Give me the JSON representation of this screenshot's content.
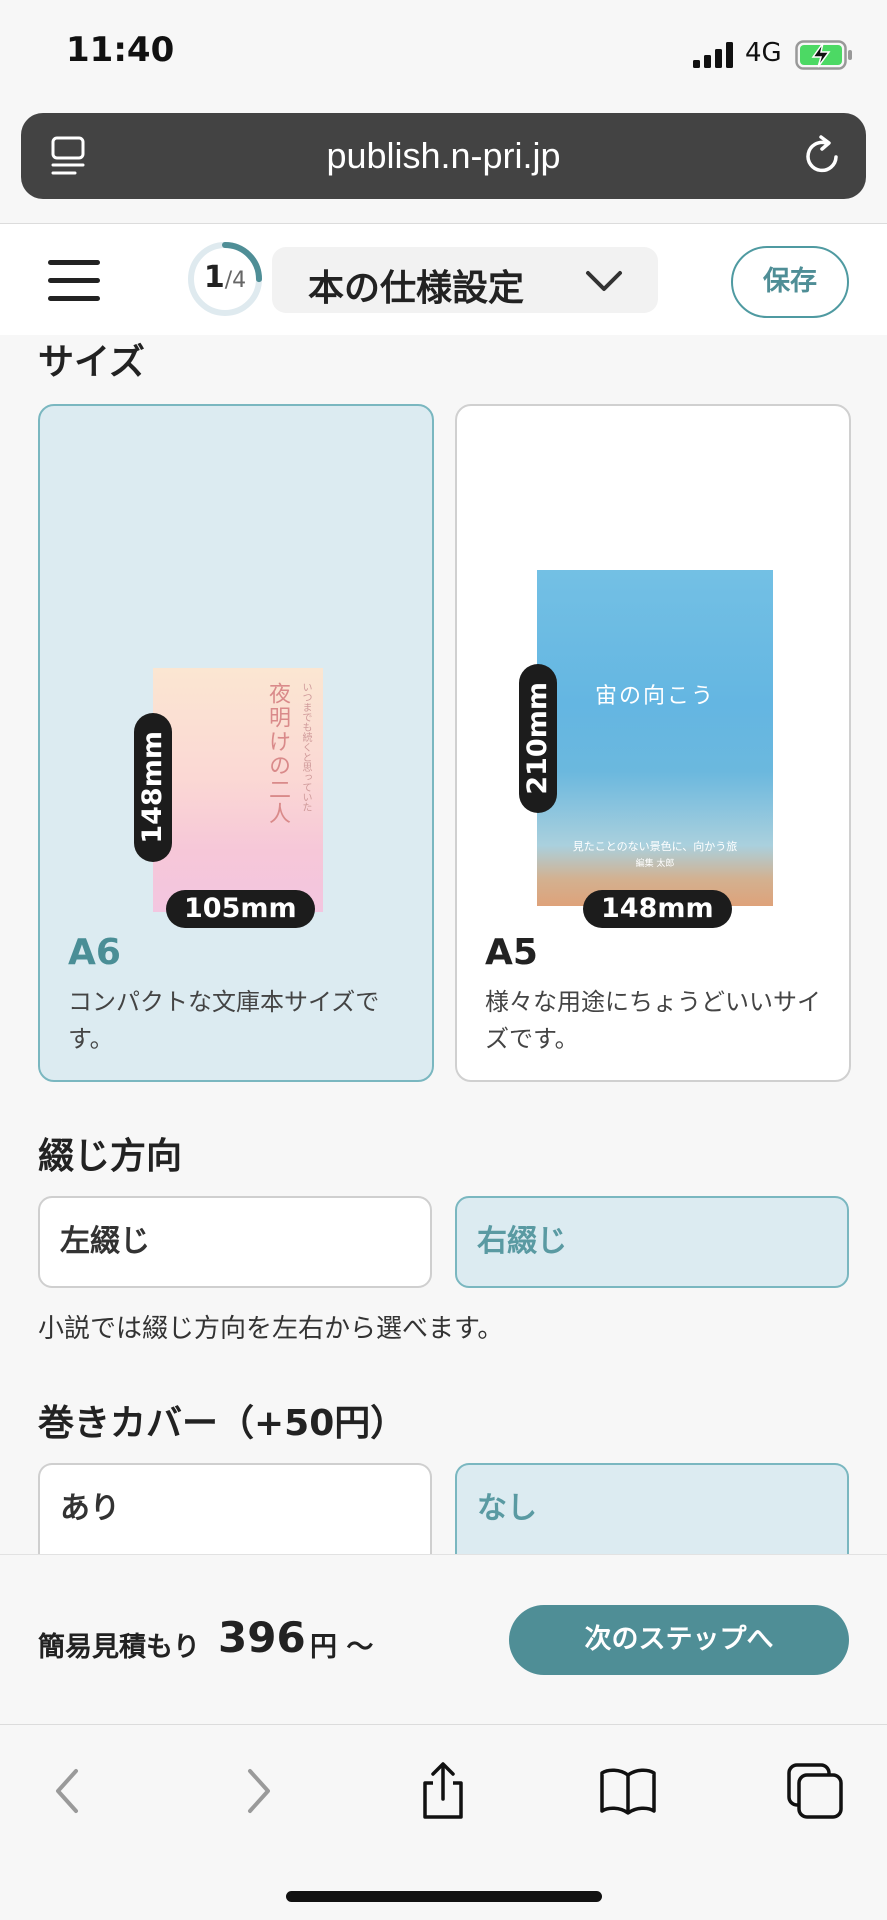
{
  "status_bar": {
    "time": "11:40",
    "network": "4G"
  },
  "browser": {
    "url": "publish.n-pri.jp"
  },
  "header": {
    "step_current": "1",
    "step_total": "/4",
    "step_progress": 0.25,
    "step_title": "本の仕様設定",
    "save_label": "保存"
  },
  "size_section": {
    "title": "サイズ",
    "options": [
      {
        "name": "A6",
        "description": "コンパクトな文庫本サイズです。",
        "height": "148mm",
        "width": "105mm",
        "selected": true,
        "cover_title": "夜明けの二人",
        "cover_subtitle": "いつまでも続くと思っていた"
      },
      {
        "name": "A5",
        "description": "様々な用途にちょうどいいサイズです。",
        "height": "210mm",
        "width": "148mm",
        "selected": false,
        "cover_title": "宙の向こう",
        "cover_subtitle": "見たことのない景色に、向かう旅",
        "cover_author": "編集 太郎"
      }
    ]
  },
  "binding_section": {
    "title": "綴じ方向",
    "options": [
      "左綴じ",
      "右綴じ"
    ],
    "selected": "右綴じ",
    "help": "小説では綴じ方向を左右から選べます。"
  },
  "cover_section": {
    "title": "巻きカバー（+50円）",
    "options": [
      "あり",
      "なし"
    ],
    "selected": "なし"
  },
  "estimate": {
    "label": "簡易見積もり",
    "price": "396",
    "unit": "円 〜",
    "next_label": "次のステップへ"
  },
  "colors": {
    "accent": "#4f8e96",
    "selected_bg": "#dcebf1",
    "selected_border": "#7ab7c0"
  }
}
